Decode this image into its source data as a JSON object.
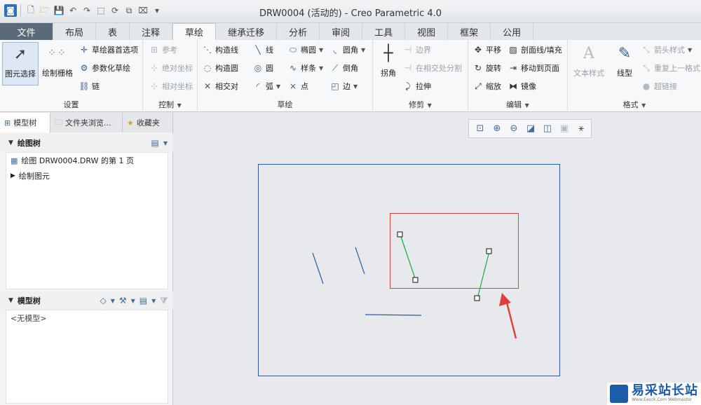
{
  "window": {
    "title": "DRW0004 (活动的) - Creo Parametric 4.0"
  },
  "ribbon_tabs": [
    {
      "label": "文件"
    },
    {
      "label": "布局"
    },
    {
      "label": "表"
    },
    {
      "label": "注释"
    },
    {
      "label": "草绘"
    },
    {
      "label": "继承迁移"
    },
    {
      "label": "分析"
    },
    {
      "label": "审阅"
    },
    {
      "label": "工具"
    },
    {
      "label": "视图"
    },
    {
      "label": "框架"
    },
    {
      "label": "公用"
    }
  ],
  "groups": {
    "settings": {
      "title": "设置",
      "select": "图元选择",
      "grid": "绘制栅格",
      "prefs": "草绘器首选项",
      "param": "参数化草绘",
      "chain": "链"
    },
    "control": {
      "title": "控制",
      "ref": "参考",
      "abs": "绝对坐标",
      "rel": "相对坐标"
    },
    "sketch": {
      "title": "草绘",
      "cline": "构造线",
      "ccircle": "构造圆",
      "intersect": "相交对",
      "line": "线",
      "circle": "圆",
      "arc": "弧",
      "ellipse": "椭圆",
      "spline": "样条",
      "point": "点",
      "fillet": "圆角",
      "chamfer": "倒角",
      "edge": "边"
    },
    "trim": {
      "title": "修剪",
      "corner": "拐角",
      "boundary": "边界",
      "divide": "在相交处分割",
      "stretch": "拉伸"
    },
    "edit": {
      "title": "编辑",
      "translate": "平移",
      "rotate": "旋转",
      "scale": "缩放",
      "hatch": "剖面线/填充",
      "move_to_page": "移动到页面",
      "mirror": "镜像"
    },
    "format": {
      "title": "格式",
      "text_style": "文本样式",
      "line_style": "线型",
      "arrow_style": "箭头样式",
      "repeat_format": "重复上一格式",
      "hyperlink": "超链接"
    }
  },
  "left_panel": {
    "tabs": [
      {
        "label": "模型树"
      },
      {
        "label": "文件夹浏览..."
      },
      {
        "label": "收藏夹"
      }
    ],
    "drawing_tree": {
      "title": "绘图树",
      "items": [
        {
          "label": "绘图 DRW0004.DRW 的第 1 页"
        },
        {
          "label": "绘制图元"
        }
      ]
    },
    "model_tree": {
      "title": "模型树",
      "empty": "<无模型>"
    }
  },
  "watermark": {
    "brand": "易采站长站",
    "sub": "Www.Easck.Com Webmaster"
  }
}
